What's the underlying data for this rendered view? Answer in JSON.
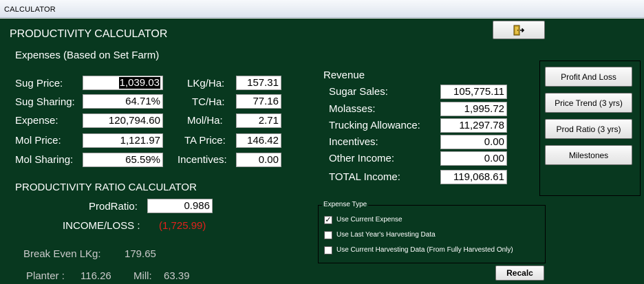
{
  "window": {
    "title": "CALCULATOR"
  },
  "exit_icon": "exit-door-icon",
  "header": {
    "title": "PRODUCTIVITY CALCULATOR",
    "subtitle": "Expenses  (Based on Set Farm)"
  },
  "expenses_left": [
    {
      "label": "Sug Price:",
      "value": "1,039.03"
    },
    {
      "label": "Sug Sharing:",
      "value": "64.71%"
    },
    {
      "label": "Expense:",
      "value": "120,794.60"
    },
    {
      "label": "Mol Price:",
      "value": "1,121.97"
    },
    {
      "label": "Mol Sharing:",
      "value": "65.59%"
    }
  ],
  "expenses_right": [
    {
      "label": "LKg/Ha:",
      "value": "157.31"
    },
    {
      "label": "TC/Ha:",
      "value": "77.16"
    },
    {
      "label": "Mol/Ha:",
      "value": "2.71"
    },
    {
      "label": "TA Price:",
      "value": "146.42"
    },
    {
      "label": "Incentives:",
      "value": "0.00"
    }
  ],
  "revenue": {
    "title": "Revenue",
    "items": [
      {
        "label": "Sugar Sales:",
        "value": "105,775.11"
      },
      {
        "label": "Molasses:",
        "value": "1,995.72"
      },
      {
        "label": "Trucking Allowance:",
        "value": "11,297.78"
      },
      {
        "label": "Incentives:",
        "value": "0.00"
      },
      {
        "label": "Other Income:",
        "value": "0.00"
      }
    ],
    "total_label": "TOTAL Income:",
    "total_value": "119,068.61"
  },
  "ratio": {
    "title": "PRODUCTIVITY RATIO CALCULATOR",
    "prodratio_label": "ProdRatio:",
    "prodratio_value": "0.986",
    "income_label": "INCOME/LOSS :",
    "income_value": "(1,725.99)",
    "breakeven_label": "Break Even LKg:",
    "breakeven_value": "179.65",
    "planter_label": "Planter :",
    "planter_value": "116.26",
    "mill_label": "Mill:",
    "mill_value": "63.39"
  },
  "side_buttons": {
    "profit_loss": "Profit And Loss",
    "price_trend": "Price Trend (3 yrs)",
    "prod_ratio": "Prod Ratio (3 yrs)",
    "milestones": "Milestones"
  },
  "expense_type": {
    "title": "Expense Type",
    "options": [
      {
        "label": "Use Current Expense",
        "checked": true
      },
      {
        "label": "Use Last Year's Harvesting Data",
        "checked": false
      },
      {
        "label": "Use Current Harvesting Data (From Fully Harvested Only)",
        "checked": false
      }
    ]
  },
  "recalc_label": "Recalc",
  "colors": {
    "panel_bg": "#08381f",
    "loss_red": "#e0211b"
  }
}
